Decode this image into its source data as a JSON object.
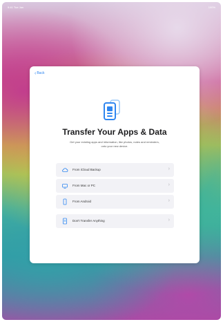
{
  "status_bar": {
    "left": "9:41 Tue Jan",
    "right": "100%"
  },
  "back": {
    "label": "Back"
  },
  "title": "Transfer Your Apps & Data",
  "subtitle": "Get your existing apps and information, like photos, notes and reminders, onto your new device.",
  "options": [
    {
      "label": "From iCloud Backup",
      "icon": "cloud-icon"
    },
    {
      "label": "From Mac or PC",
      "icon": "computer-icon"
    },
    {
      "label": "From Android",
      "icon": "phone-icon"
    }
  ],
  "skip_option": {
    "label": "Don't Transfer Anything",
    "icon": "tablet-icon"
  },
  "colors": {
    "accent": "#2e86f0",
    "option_bg": "#f2f2f6"
  }
}
